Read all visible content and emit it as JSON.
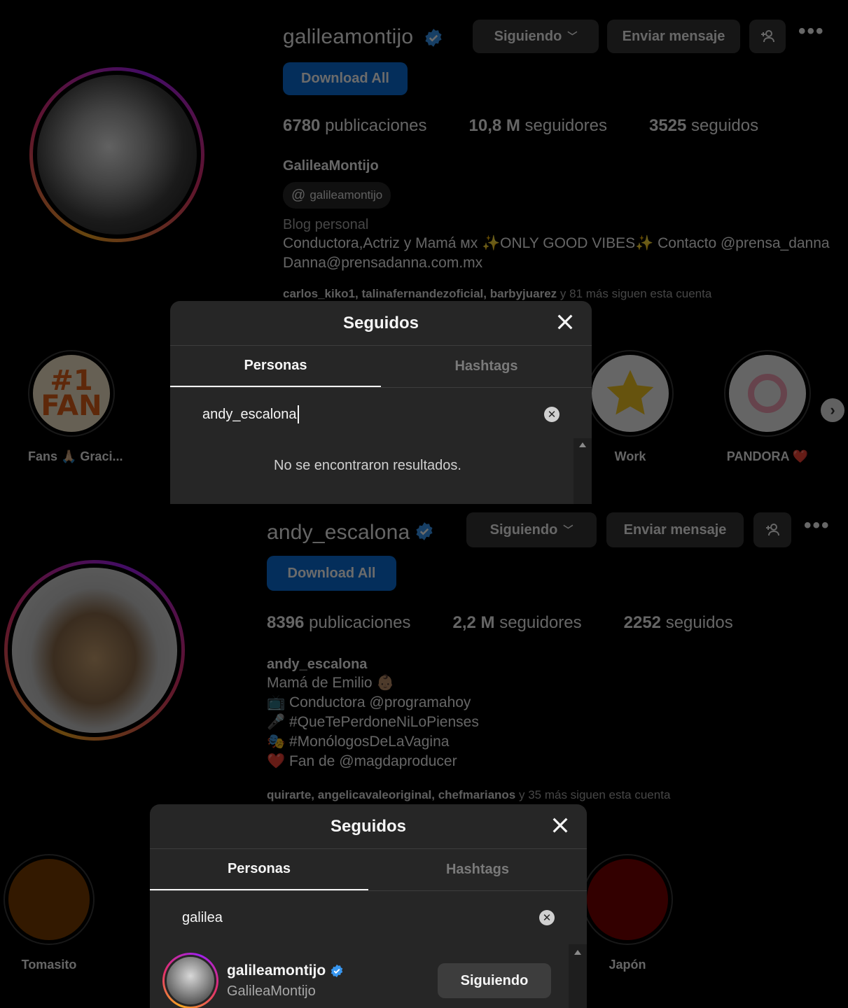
{
  "colors": {
    "background": "#000000",
    "button_blue": "#0a6fd8",
    "button_gray": "#363636",
    "modal_bg": "#262626",
    "verified": "#3897f0"
  },
  "top_profile": {
    "username": "galileamontijo",
    "following_button": "Siguiendo",
    "message_button": "Enviar mensaje",
    "download_button": "Download All",
    "stats": {
      "posts": "6780",
      "posts_label": "publicaciones",
      "followers": "10,8 M",
      "followers_label": "seguidores",
      "following": "3525",
      "following_label": "seguidos"
    },
    "full_name": "GalileaMontijo",
    "threads_handle": "galileamontijo",
    "category": "Blog personal",
    "bio_line1": "Conductora,Actriz y Mamá ᴍx ✨ONLY GOOD VIBES✨ Contacto @prensa_danna",
    "bio_line2": "Danna@prensadanna.com.mx",
    "followed_by_names": "carlos_kiko1, talinafernandezoficial, barbyjuarez",
    "followed_by_rest": "y 81 más siguen esta cuenta",
    "highlights": [
      {
        "label": "Fans 🙏🏼 Graci...",
        "icon": "fan-badge-icon"
      },
      {
        "label": "Work",
        "icon": "thank-you-star-icon"
      },
      {
        "label": "PANDORA ❤️",
        "icon": "pandora-ring-icon"
      }
    ],
    "modal": {
      "title": "Seguidos",
      "tab_people": "Personas",
      "tab_hashtags": "Hashtags",
      "search_value": "andy_escalona",
      "empty_message": "No se encontraron resultados."
    }
  },
  "bottom_profile": {
    "username": "andy_escalona",
    "following_button": "Siguiendo",
    "message_button": "Enviar mensaje",
    "download_button": "Download All",
    "stats": {
      "posts": "8396",
      "posts_label": "publicaciones",
      "followers": "2,2 M",
      "followers_label": "seguidores",
      "following": "2252",
      "following_label": "seguidos"
    },
    "full_name": "andy_escalona",
    "bio_lines": [
      "Mamá de Emilio 👶🏽",
      "📺 Conductora @programahoy",
      "🎤 #QueTePerdoneNiLoPienses",
      "🎭 #MonólogosDeLaVagina",
      "❤️ Fan de @magdaproducer"
    ],
    "followed_by_names": "quirarte, angelicavaleoriginal, chefmarianos",
    "followed_by_rest": "y 35 más siguen esta cuenta",
    "highlights": [
      {
        "label": "Tomasito",
        "color": "#7a3d00"
      },
      {
        "label": "Japón",
        "color": "#7a0000"
      }
    ],
    "modal": {
      "title": "Seguidos",
      "tab_people": "Personas",
      "tab_hashtags": "Hashtags",
      "search_value": "galilea",
      "result": {
        "username": "galileamontijo",
        "full_name": "GalileaMontijo",
        "button": "Siguiendo"
      }
    }
  }
}
